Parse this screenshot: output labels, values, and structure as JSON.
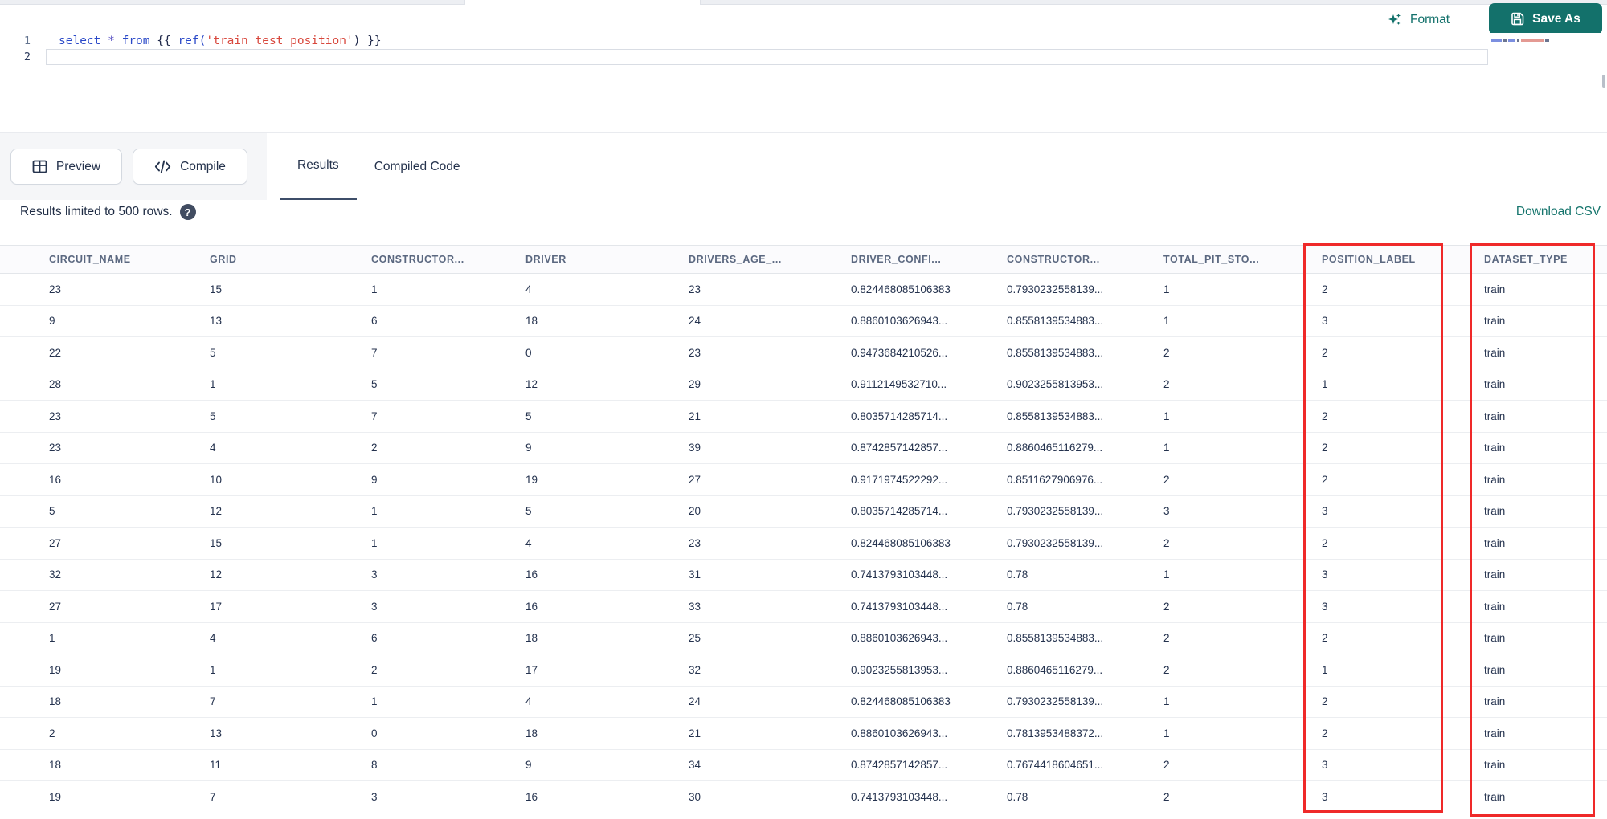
{
  "topbar": {
    "format_label": "Format",
    "save_as_label": "Save As"
  },
  "editor": {
    "lines": [
      {
        "number": "1",
        "tokens": [
          {
            "text": "select",
            "type": "kw"
          },
          {
            "text": " ",
            "type": "plain"
          },
          {
            "text": "*",
            "type": "op"
          },
          {
            "text": " ",
            "type": "plain"
          },
          {
            "text": "from",
            "type": "kw"
          },
          {
            "text": " ",
            "type": "plain"
          },
          {
            "text": "{{",
            "type": "punct"
          },
          {
            "text": " ",
            "type": "plain"
          },
          {
            "text": "ref(",
            "type": "fn"
          },
          {
            "text": "'train_test_position'",
            "type": "str"
          },
          {
            "text": ")",
            "type": "punct"
          },
          {
            "text": " ",
            "type": "plain"
          },
          {
            "text": "}}",
            "type": "punct"
          }
        ]
      },
      {
        "number": "2",
        "tokens": []
      }
    ]
  },
  "toolbar": {
    "preview_label": "Preview",
    "compile_label": "Compile",
    "tabs": [
      {
        "label": "Results",
        "active": true
      },
      {
        "label": "Compiled Code",
        "active": false
      }
    ]
  },
  "results_bar": {
    "limit_text": "Results limited to 500 rows.",
    "download_csv_label": "Download CSV"
  },
  "icons": {
    "help_glyph": "?"
  },
  "table": {
    "columns": [
      "CIRCUIT_NAME",
      "GRID",
      "CONSTRUCTOR...",
      "DRIVER",
      "DRIVERS_AGE_...",
      "DRIVER_CONFI...",
      "CONSTRUCTOR...",
      "TOTAL_PIT_STO...",
      "POSITION_LABEL",
      "DATASET_TYPE"
    ],
    "rows": [
      [
        "23",
        "15",
        "1",
        "4",
        "23",
        "0.824468085106383",
        "0.7930232558139...",
        "1",
        "2",
        "train"
      ],
      [
        "9",
        "13",
        "6",
        "18",
        "24",
        "0.8860103626943...",
        "0.8558139534883...",
        "1",
        "3",
        "train"
      ],
      [
        "22",
        "5",
        "7",
        "0",
        "23",
        "0.9473684210526...",
        "0.8558139534883...",
        "2",
        "2",
        "train"
      ],
      [
        "28",
        "1",
        "5",
        "12",
        "29",
        "0.9112149532710...",
        "0.9023255813953...",
        "2",
        "1",
        "train"
      ],
      [
        "23",
        "5",
        "7",
        "5",
        "21",
        "0.8035714285714...",
        "0.8558139534883...",
        "1",
        "2",
        "train"
      ],
      [
        "23",
        "4",
        "2",
        "9",
        "39",
        "0.8742857142857...",
        "0.8860465116279...",
        "1",
        "2",
        "train"
      ],
      [
        "16",
        "10",
        "9",
        "19",
        "27",
        "0.9171974522292...",
        "0.8511627906976...",
        "2",
        "2",
        "train"
      ],
      [
        "5",
        "12",
        "1",
        "5",
        "20",
        "0.8035714285714...",
        "0.7930232558139...",
        "3",
        "3",
        "train"
      ],
      [
        "27",
        "15",
        "1",
        "4",
        "23",
        "0.824468085106383",
        "0.7930232558139...",
        "2",
        "2",
        "train"
      ],
      [
        "32",
        "12",
        "3",
        "16",
        "31",
        "0.7413793103448...",
        "0.78",
        "1",
        "3",
        "train"
      ],
      [
        "27",
        "17",
        "3",
        "16",
        "33",
        "0.7413793103448...",
        "0.78",
        "2",
        "3",
        "train"
      ],
      [
        "1",
        "4",
        "6",
        "18",
        "25",
        "0.8860103626943...",
        "0.8558139534883...",
        "2",
        "2",
        "train"
      ],
      [
        "19",
        "1",
        "2",
        "17",
        "32",
        "0.9023255813953...",
        "0.8860465116279...",
        "2",
        "1",
        "train"
      ],
      [
        "18",
        "7",
        "1",
        "4",
        "24",
        "0.824468085106383",
        "0.7930232558139...",
        "1",
        "2",
        "train"
      ],
      [
        "2",
        "13",
        "0",
        "18",
        "21",
        "0.8860103626943...",
        "0.7813953488372...",
        "1",
        "2",
        "train"
      ],
      [
        "18",
        "11",
        "8",
        "9",
        "34",
        "0.8742857142857...",
        "0.7674418604651...",
        "2",
        "3",
        "train"
      ],
      [
        "19",
        "7",
        "3",
        "16",
        "30",
        "0.7413793103448...",
        "0.78",
        "2",
        "3",
        "train"
      ]
    ]
  },
  "annotations": {
    "highlighted_columns": [
      "POSITION_LABEL",
      "DATASET_TYPE"
    ],
    "box_color": "#ef2929"
  },
  "colors": {
    "teal": "#13716b",
    "tab_underline": "#3e4e69",
    "keyword_blue": "#2948c8",
    "string_red": "#d8473c"
  }
}
